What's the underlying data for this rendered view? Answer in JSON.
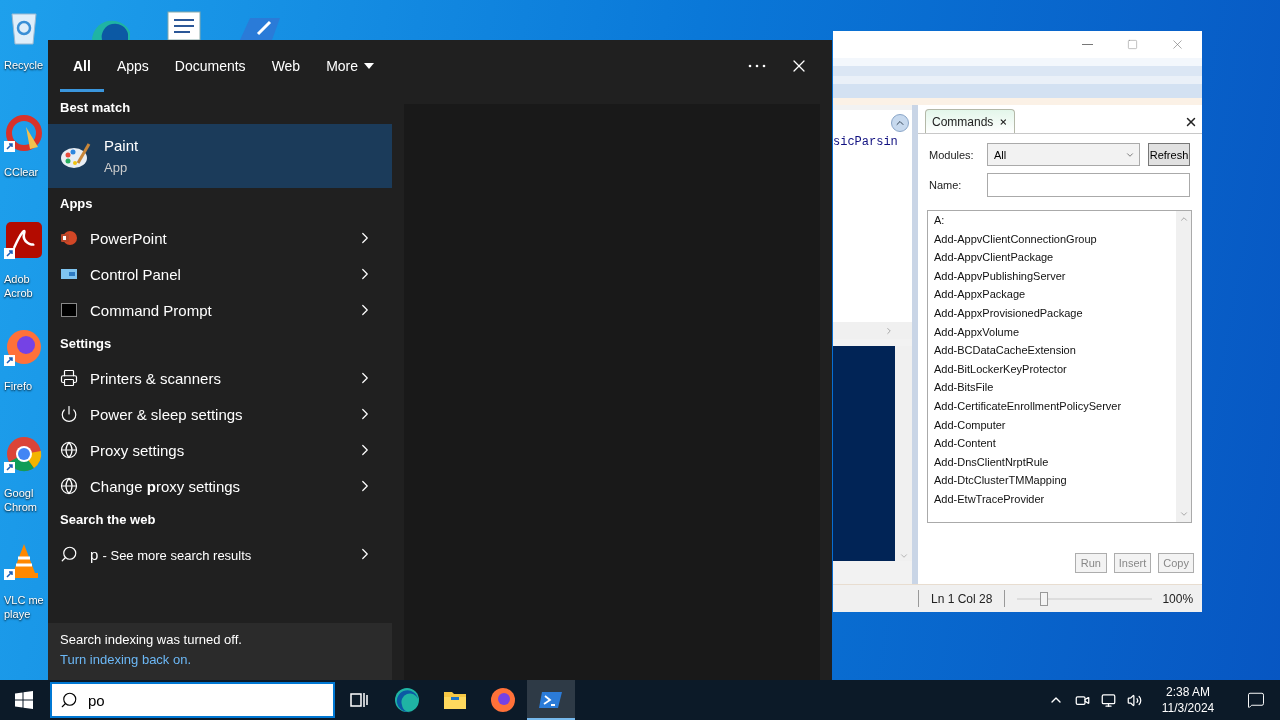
{
  "desktop": {
    "icons": [
      {
        "kind": "recycle-bin",
        "lines": [
          "Recycle"
        ]
      },
      {
        "kind": "ccleaner",
        "lines": [
          "CClear"
        ]
      },
      {
        "kind": "acrobat",
        "lines": [
          "Adob",
          "Acrob"
        ]
      },
      {
        "kind": "firefox",
        "lines": [
          "Firefo"
        ]
      },
      {
        "kind": "chrome",
        "lines": [
          "Googl",
          "Chrom"
        ]
      },
      {
        "kind": "vlc",
        "lines": [
          "VLC me",
          "playe"
        ]
      }
    ],
    "top_icons": [
      {
        "kind": "edge"
      },
      {
        "kind": "document"
      },
      {
        "kind": "blue-app"
      }
    ]
  },
  "search_panel": {
    "tabs": [
      {
        "label": "All",
        "kind": "tab",
        "selected": true
      },
      {
        "label": "Apps",
        "kind": "tab",
        "selected": false
      },
      {
        "label": "Documents",
        "kind": "tab",
        "selected": false
      },
      {
        "label": "Web",
        "kind": "tab",
        "selected": false
      },
      {
        "label": "More",
        "kind": "menu",
        "selected": false
      }
    ],
    "best_match": {
      "heading": "Best match",
      "title": "Paint",
      "subtitle": "App",
      "selected": true
    },
    "sections": [
      {
        "heading": "Apps",
        "items": [
          {
            "kind": "powerpoint",
            "label": "PowerPoint"
          },
          {
            "kind": "control-panel",
            "label": "Control Panel"
          },
          {
            "kind": "command-prompt",
            "label": "Command Prompt"
          }
        ]
      },
      {
        "heading": "Settings",
        "items": [
          {
            "kind": "printer",
            "label": "Printers & scanners"
          },
          {
            "kind": "power",
            "label": "Power & sleep settings"
          },
          {
            "kind": "globe",
            "label": "Proxy settings"
          },
          {
            "kind": "globe",
            "label": "Change **p**roxy settings"
          }
        ]
      },
      {
        "heading": "Search the web",
        "items": [
          {
            "kind": "search",
            "query": "p",
            "label": "- See more search results"
          }
        ]
      }
    ],
    "notice": {
      "text": "Search indexing was turned off.",
      "link": "Turn indexing back on."
    }
  },
  "ise_window": {
    "script_text": "sicParsin",
    "commands": {
      "tab": "Commands",
      "modules_label": "Modules:",
      "modules_value": "All",
      "refresh": "Refresh",
      "name_label": "Name:",
      "list": [
        "A:",
        "Add-AppvClientConnectionGroup",
        "Add-AppvClientPackage",
        "Add-AppvPublishingServer",
        "Add-AppxPackage",
        "Add-AppxProvisionedPackage",
        "Add-AppxVolume",
        "Add-BCDataCacheExtension",
        "Add-BitLockerKeyProtector",
        "Add-BitsFile",
        "Add-CertificateEnrollmentPolicyServer",
        "Add-Computer",
        "Add-Content",
        "Add-DnsClientNrptRule",
        "Add-DtcClusterTMMapping",
        "Add-EtwTraceProvider"
      ],
      "buttons": [
        {
          "label": "Run",
          "disabled": true
        },
        {
          "label": "Insert",
          "disabled": true
        },
        {
          "label": "Copy",
          "disabled": true
        }
      ]
    },
    "status_bar": {
      "position": "Ln 1 Col 28",
      "zoom_slider": {
        "level": 0.2
      },
      "zoom": "100%"
    }
  },
  "taskbar": {
    "search": {
      "value": "po"
    },
    "apps": [
      {
        "kind": "task-view",
        "selected": false
      },
      {
        "kind": "edge",
        "selected": false
      },
      {
        "kind": "explorer",
        "selected": false
      },
      {
        "kind": "firefox",
        "selected": false
      },
      {
        "kind": "powershell-ise",
        "selected": true
      }
    ],
    "time": "2:38 AM",
    "date": "11/3/2024"
  }
}
